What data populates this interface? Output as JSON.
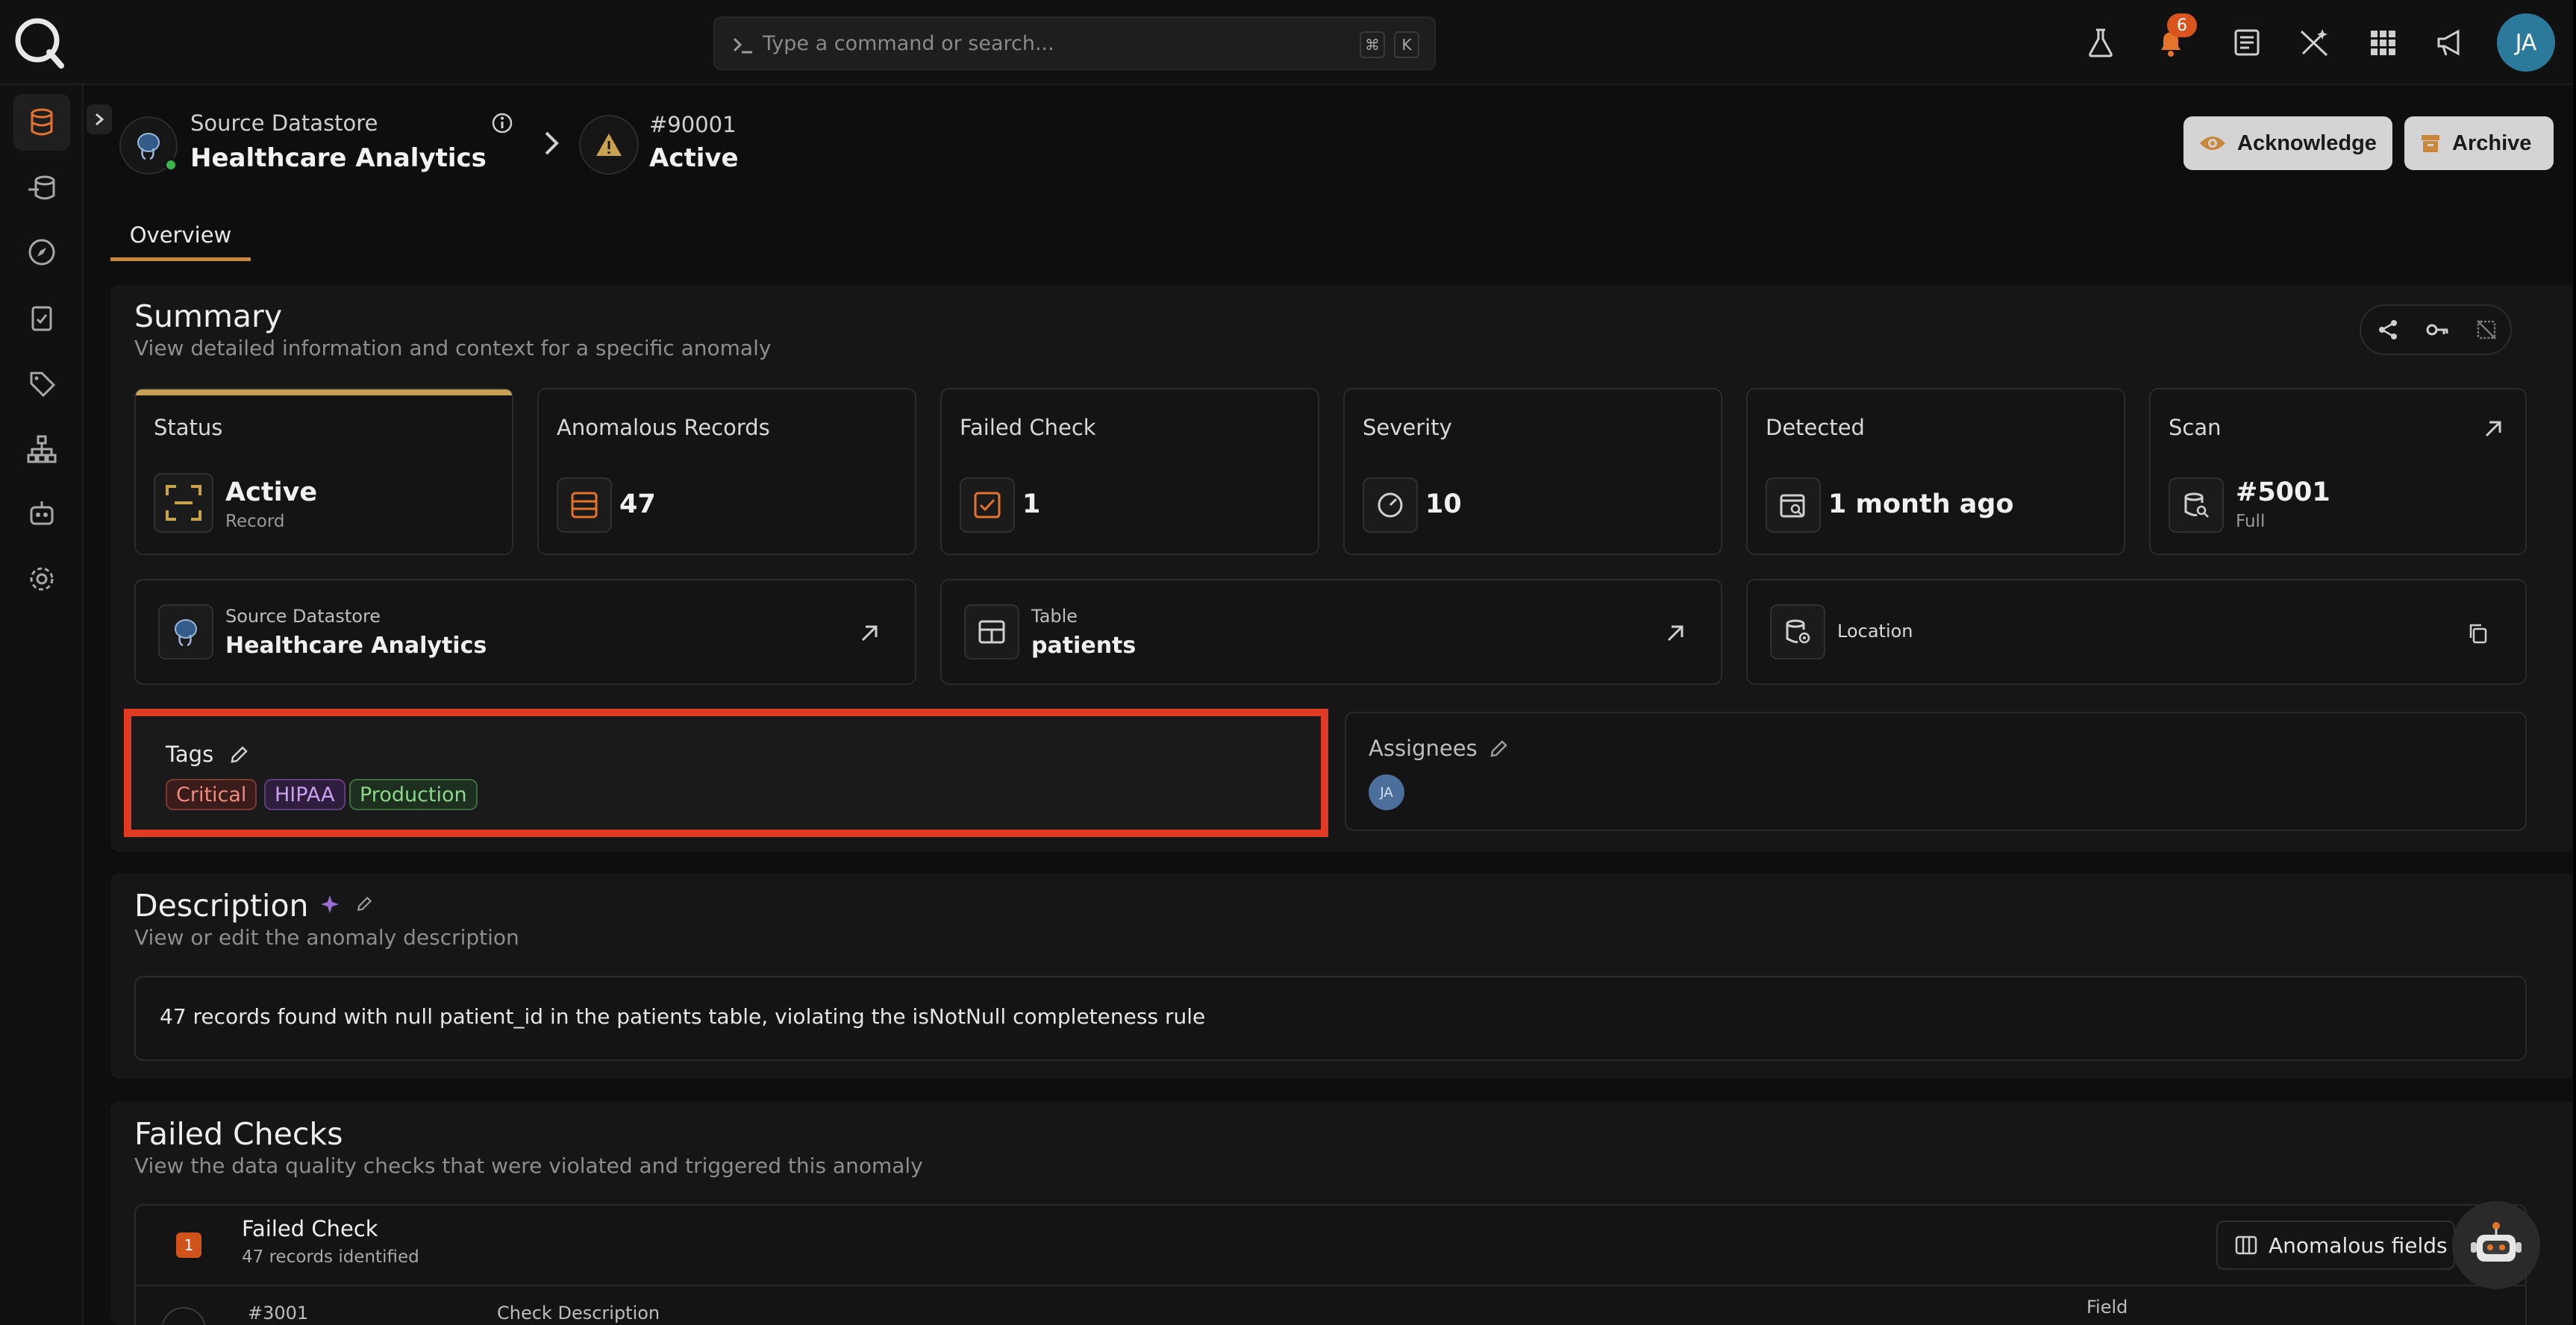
{
  "topbar": {
    "search_placeholder": "Type a command or search...",
    "shortcut_keys": [
      "⌘",
      "K"
    ],
    "notification_count": "6",
    "avatar_initials": "JA"
  },
  "header": {
    "datastore_label": "Source Datastore",
    "datastore_name": "Healthcare Analytics",
    "anomaly_id": "#90001",
    "anomaly_status": "Active",
    "acknowledge_label": "Acknowledge",
    "archive_label": "Archive",
    "tab_overview": "Overview"
  },
  "summary": {
    "title": "Summary",
    "subtitle": "View detailed information and context for a specific anomaly",
    "cards": {
      "status": {
        "label": "Status",
        "value": "Active",
        "sub": "Record"
      },
      "anomalous_records": {
        "label": "Anomalous Records",
        "value": "47"
      },
      "failed_check": {
        "label": "Failed Check",
        "value": "1"
      },
      "severity": {
        "label": "Severity",
        "value": "10"
      },
      "detected": {
        "label": "Detected",
        "value": "1 month ago"
      },
      "scan": {
        "label": "Scan",
        "value": "#5001",
        "sub": "Full"
      }
    },
    "source_datastore": {
      "label": "Source Datastore",
      "value": "Healthcare Analytics"
    },
    "table": {
      "label": "Table",
      "value": "patients"
    },
    "location": {
      "label": "Location"
    },
    "tags": {
      "label": "Tags",
      "items": [
        "Critical",
        "HIPAA",
        "Production"
      ]
    },
    "assignees": {
      "label": "Assignees",
      "initials": "JA"
    }
  },
  "description": {
    "title": "Description",
    "subtitle": "View or edit the anomaly description",
    "text": "47 records found with null patient_id in the patients table, violating the isNotNull completeness rule"
  },
  "failed_checks": {
    "title": "Failed Checks",
    "subtitle": "View the data quality checks that were violated and triggered this anomaly",
    "count_badge": "1",
    "header_title": "Failed Check",
    "header_sub": "47 records identified",
    "anomalous_fields_label": "Anomalous fields",
    "row_id": "#3001",
    "col_check_description": "Check Description",
    "col_field": "Field"
  },
  "colors": {
    "accent": "#c8873a",
    "highlight_border": "#e03a22",
    "tag_critical": "#e0665a",
    "tag_hipaa": "#b78be0",
    "tag_production": "#7fcf7a"
  }
}
